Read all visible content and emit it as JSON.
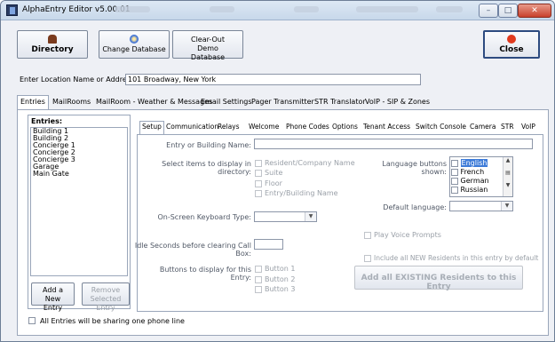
{
  "window": {
    "title": "AlphaEntry Editor v5.00.01",
    "min_glyph": "–",
    "max_glyph": "□",
    "close_glyph": "✕"
  },
  "toolbar": {
    "directory": "Directory",
    "change_db": "Change Database",
    "clear_out": "Clear-Out Demo Database",
    "close": "Close",
    "colors": {
      "directory_icon": "#7a3b1e",
      "change_db_icon": "#3a6fd6",
      "close_icon": "#e03a1e"
    }
  },
  "location": {
    "label": "Enter Location Name or Address:",
    "value": "101 Broadway, New York"
  },
  "outer_tabs": [
    {
      "label": "Entries",
      "selected": true
    },
    {
      "label": "MailRooms"
    },
    {
      "label": "MailRoom - Weather & Messages"
    },
    {
      "label": "Email Settings"
    },
    {
      "label": "Pager Transmitter"
    },
    {
      "label": "STR Translator"
    },
    {
      "label": "VoIP - SIP & Zones"
    }
  ],
  "entries": {
    "title": "Entries:",
    "items": [
      "Building 1",
      "Building 2",
      "Concierge 1",
      "Concierge 2",
      "Concierge 3",
      "Garage",
      "Main Gate"
    ],
    "add_button": "Add a New Entry",
    "remove_button": "Remove Selected Entry",
    "share_label": "All Entries will be sharing one phone line"
  },
  "inner_tabs": [
    {
      "label": "Setup",
      "selected": true
    },
    {
      "label": "Communication"
    },
    {
      "label": "Relays"
    },
    {
      "label": "Welcome"
    },
    {
      "label": "Phone Codes"
    },
    {
      "label": "Options"
    },
    {
      "label": "Tenant Access"
    },
    {
      "label": "Switch Console"
    },
    {
      "label": "Camera"
    },
    {
      "label": "STR"
    },
    {
      "label": "VoIP"
    }
  ],
  "setup": {
    "entry_name_label": "Entry or Building Name:",
    "entry_name_value": "",
    "directory_items_label": "Select items to display in directory:",
    "directory_items": [
      "Resident/Company Name",
      "Suite",
      "Floor",
      "Entry/Building Name"
    ],
    "keyboard_label": "On-Screen Keyboard Type:",
    "keyboard_value": "",
    "idle_label": "Idle Seconds before clearing Call Box:",
    "idle_value": "",
    "buttons_label": "Buttons to display for this Entry:",
    "buttons": [
      "Button 1",
      "Button 2",
      "Button 3"
    ],
    "language_label": "Language buttons shown:",
    "languages": [
      {
        "name": "English",
        "selected": true
      },
      {
        "name": "French"
      },
      {
        "name": "German"
      },
      {
        "name": "Russian"
      }
    ],
    "default_language_label": "Default language:",
    "default_language_value": "",
    "voice_prompts_label": "Play Voice Prompts",
    "include_new_label": "Include all NEW Residents in this entry by default",
    "add_all_button": "Add all EXISTING Residents to this Entry"
  }
}
